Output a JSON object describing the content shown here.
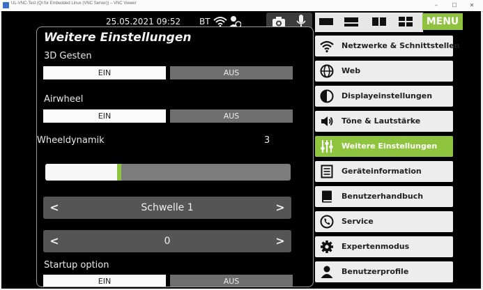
{
  "window": {
    "title": "UL-VNC-Test (Qt for Embedded Linux (VNC Server)) – VNC Viewer",
    "minimize": "–",
    "maximize": "☐",
    "close": "✕"
  },
  "status": {
    "datetime": "25.05.2021 09:52",
    "bt": "BT",
    "menu_label": "MENU"
  },
  "panel": {
    "title": "Weitere Einstellungen",
    "gesten": {
      "label": "3D Gesten",
      "on": "EIN",
      "off": "AUS",
      "selected": "EIN"
    },
    "airwheel": {
      "label": "Airwheel",
      "on": "EIN",
      "off": "AUS",
      "selected": "EIN"
    },
    "wheel": {
      "label": "Wheeldynamik",
      "value": "3",
      "level": 0.3
    },
    "schwelle": {
      "value": "Schwelle 1",
      "left": "<",
      "right": ">"
    },
    "stepper2": {
      "value": "0",
      "left": "<",
      "right": ">"
    },
    "startup": {
      "label": "Startup option",
      "on": "EIN",
      "off": "AUS",
      "selected": "EIN"
    }
  },
  "sidebar": {
    "items": [
      {
        "label": "Netzwerke & Schnittstellen",
        "icon": "wifi-icon"
      },
      {
        "label": "Web",
        "icon": "globe-icon"
      },
      {
        "label": "Displayeinstellungen",
        "icon": "contrast-icon"
      },
      {
        "label": "Töne & Lautstärke",
        "icon": "speaker-icon"
      },
      {
        "label": "Weitere Einstellungen",
        "icon": "sliders-icon",
        "active": true
      },
      {
        "label": "Geräteinformation",
        "icon": "document-icon"
      },
      {
        "label": "Benutzerhandbuch",
        "icon": "book-icon"
      },
      {
        "label": "Service",
        "icon": "phone-icon"
      },
      {
        "label": "Expertenmodus",
        "icon": "gear-icon"
      },
      {
        "label": "Benutzerprofile",
        "icon": "user-icon"
      }
    ]
  },
  "colors": {
    "accent": "#8ec43e",
    "background": "#000000",
    "button_off": "#6e6e6e",
    "sidebar_bg": "#ededed"
  }
}
